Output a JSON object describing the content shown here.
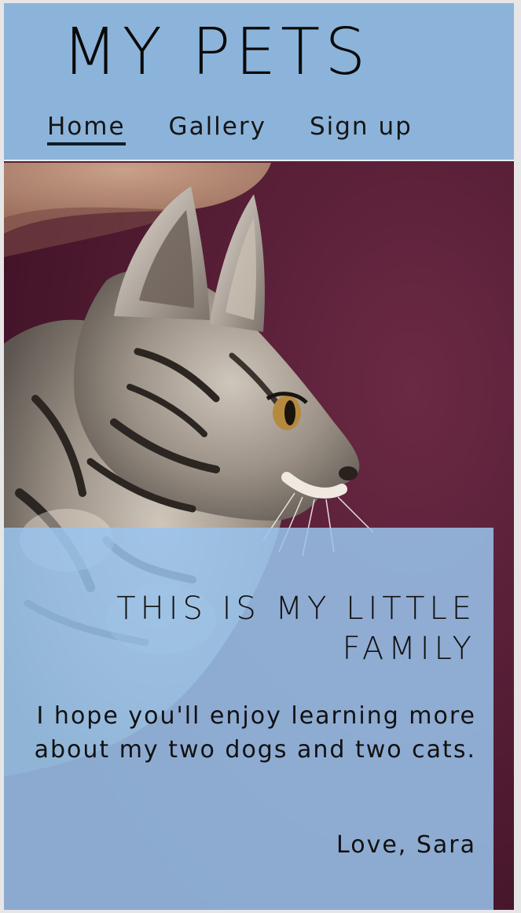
{
  "header": {
    "title": "MY PETS",
    "nav": [
      {
        "label": "Home",
        "active": true
      },
      {
        "label": "Gallery",
        "active": false
      },
      {
        "label": "Sign up",
        "active": false
      }
    ]
  },
  "hero": {
    "image_subject": "tabby-kitten-photo"
  },
  "card": {
    "title": "THIS IS MY LITTLE FAMILY",
    "body": "I hope you'll enjoy learning more about my two dogs and two cats.",
    "signature": "Love, Sara"
  },
  "colors": {
    "header_bg": "#8cb4da",
    "card_bg": "#98c4ec",
    "nav_underline": "#0d1d2b",
    "sweater": "#581c34"
  }
}
